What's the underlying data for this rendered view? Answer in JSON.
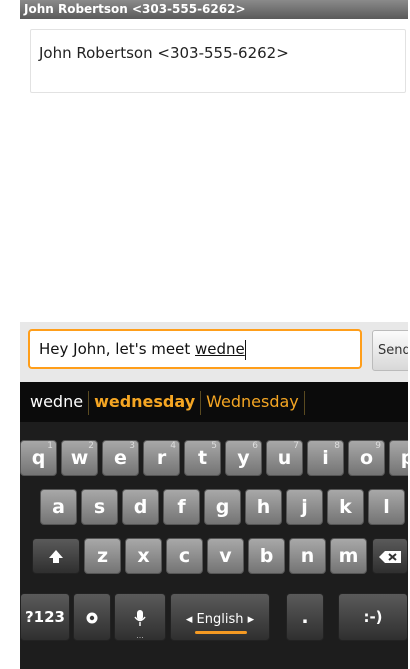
{
  "title_bar": {
    "text": "John Robertson <303-555-6262>"
  },
  "recipient": {
    "text": "John Robertson <303-555-6262>"
  },
  "compose": {
    "text_before": "Hey John, let's meet ",
    "text_composing": "wedne",
    "send_label": "Send"
  },
  "suggestions": {
    "typed": "wedne",
    "best": "wednesday",
    "alt": "Wednesday"
  },
  "keyboard": {
    "row1": [
      {
        "label": "q",
        "hint": "1"
      },
      {
        "label": "w",
        "hint": "2"
      },
      {
        "label": "e",
        "hint": "3"
      },
      {
        "label": "r",
        "hint": "4"
      },
      {
        "label": "t",
        "hint": "5"
      },
      {
        "label": "y",
        "hint": "6"
      },
      {
        "label": "u",
        "hint": "7"
      },
      {
        "label": "i",
        "hint": "8"
      },
      {
        "label": "o",
        "hint": "9"
      },
      {
        "label": "p",
        "hint": ""
      }
    ],
    "row2": [
      "a",
      "s",
      "d",
      "f",
      "g",
      "h",
      "j",
      "k",
      "l"
    ],
    "row3": [
      "z",
      "x",
      "c",
      "v",
      "b",
      "n",
      "m"
    ],
    "shift_icon": "shift-arrow-icon",
    "delete_icon": "backspace-icon",
    "symbols_label": "?123",
    "settings_icon": "settings-gear-icon",
    "mic_icon": "microphone-icon",
    "mic_dots": "...",
    "language_label": "◂ English ▸",
    "period_label": ".",
    "smiley_label": ":-)",
    "accent_color": "#f5a623"
  }
}
